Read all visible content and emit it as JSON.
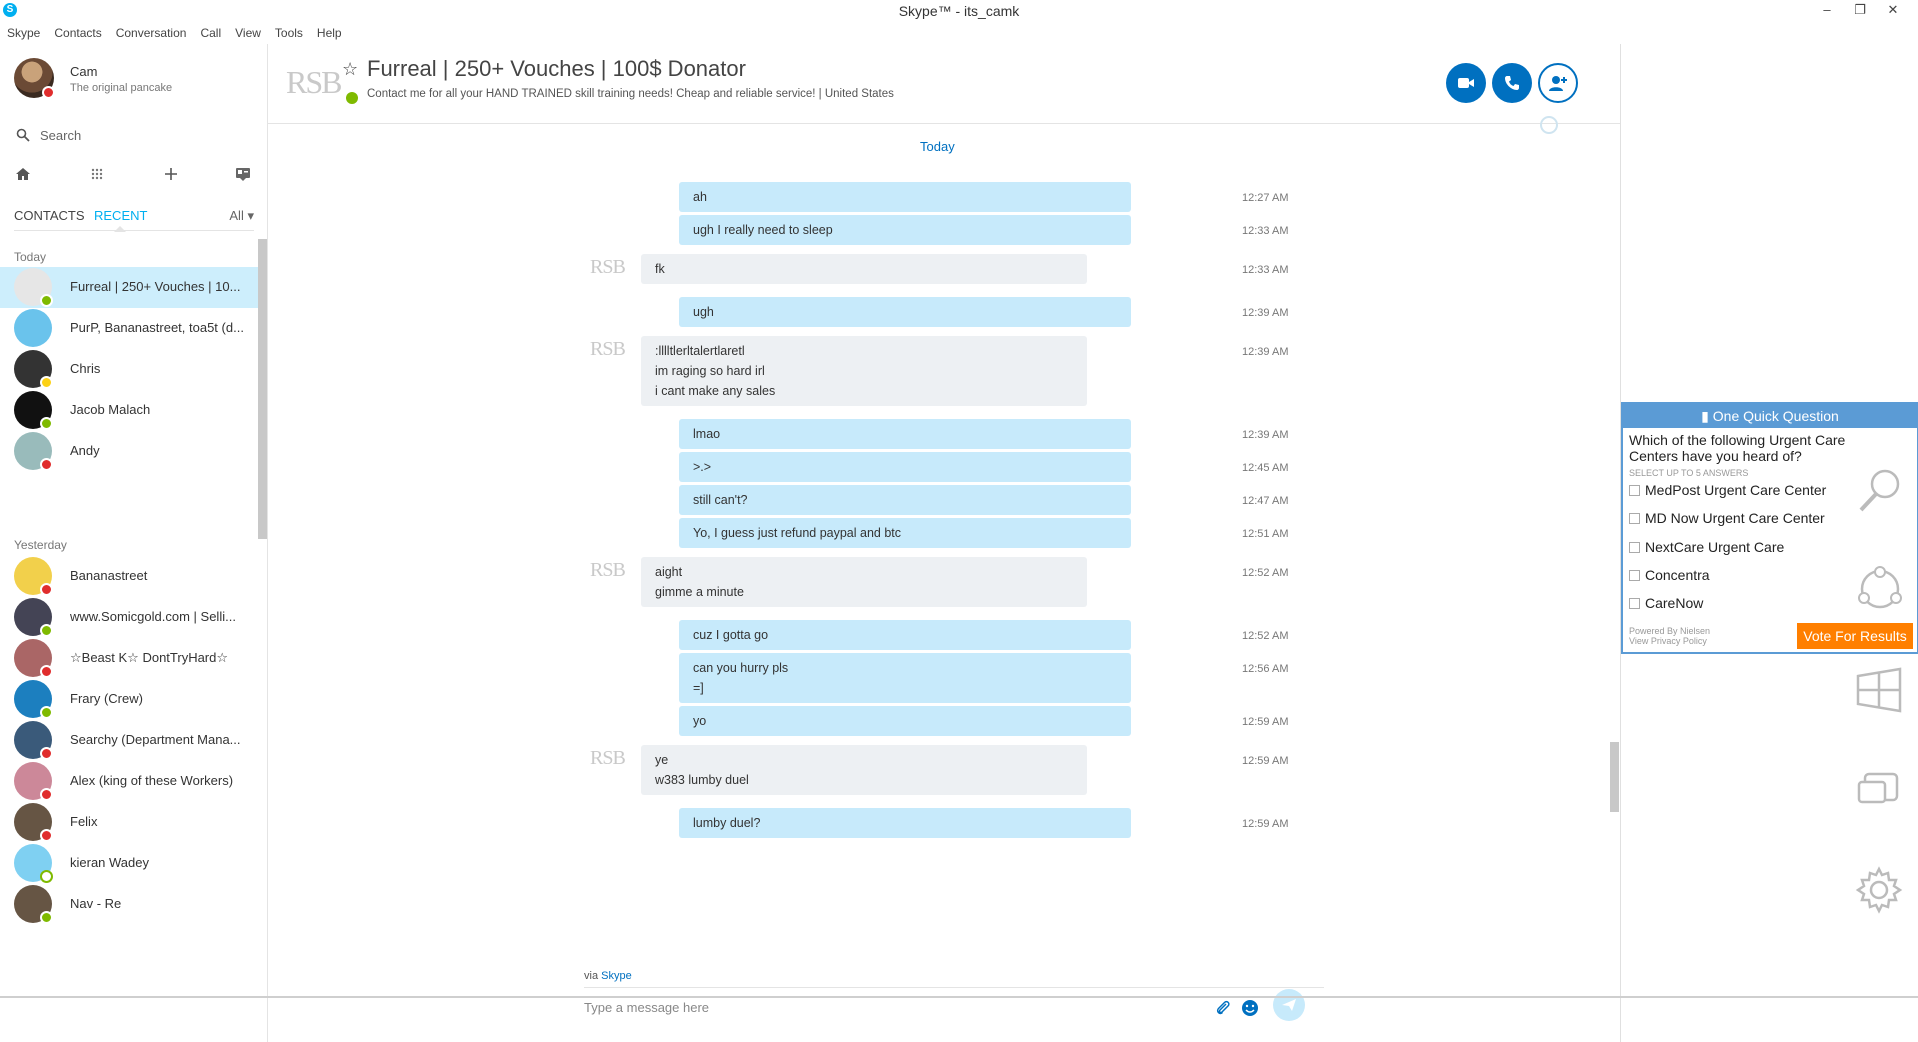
{
  "window": {
    "title": "Skype™ - its_camk",
    "minimize": "–",
    "restore": "❐",
    "close": "✕"
  },
  "menu": [
    "Skype",
    "Contacts",
    "Conversation",
    "Call",
    "View",
    "Tools",
    "Help"
  ],
  "profile": {
    "name": "Cam",
    "mood": "The original pancake",
    "status": "dnd"
  },
  "search": {
    "placeholder": "Search"
  },
  "nav_icons": [
    "home-icon",
    "dialpad-icon",
    "add-icon",
    "contacts-card-icon"
  ],
  "tabs": {
    "contacts": "CONTACTS",
    "recent": "RECENT",
    "filter": "All"
  },
  "groups": {
    "today": "Today",
    "yesterday": "Yesterday"
  },
  "contacts_today": [
    {
      "name": "Furreal | 250+ Vouches | 10...",
      "status": "online",
      "active": true
    },
    {
      "name": "PurP, Bananastreet, toa5t (d...",
      "status": "none"
    },
    {
      "name": "Chris",
      "status": "away"
    },
    {
      "name": "Jacob Malach",
      "status": "online"
    },
    {
      "name": "Andy",
      "status": "dnd"
    }
  ],
  "contacts_yesterday": [
    {
      "name": "Bananastreet",
      "status": "dnd"
    },
    {
      "name": "www.Somicgold.com  | Selli...",
      "status": "online"
    },
    {
      "name": "☆Beast K☆ DontTryHard☆",
      "status": "dnd"
    },
    {
      "name": "Frary (Crew)",
      "status": "online"
    },
    {
      "name": "Searchy (Department Mana...",
      "status": "dnd"
    },
    {
      "name": "Alex (king of these Workers)",
      "status": "dnd"
    },
    {
      "name": "Felix",
      "status": "dnd"
    },
    {
      "name": "kieran Wadey",
      "status": "offline"
    },
    {
      "name": "Nav - Re",
      "status": "online"
    }
  ],
  "conversation": {
    "logo_text": "RSB",
    "title": "Furreal | 250+ Vouches | 100$ Donator",
    "mood": "Contact me for all your HAND TRAINED skill training needs! Cheap and reliable service!  |  United States",
    "day_label": "Today",
    "call_buttons": [
      "video-call-icon",
      "voice-call-icon",
      "add-people-icon"
    ],
    "messages": [
      {
        "dir": "out",
        "lines": [
          "ah"
        ],
        "time": "12:27 AM"
      },
      {
        "dir": "out",
        "lines": [
          "ugh I really need to sleep"
        ],
        "time": "12:33 AM"
      },
      {
        "dir": "in",
        "lines": [
          "fk"
        ],
        "time": "12:33 AM"
      },
      {
        "dir": "out",
        "lines": [
          "ugh"
        ],
        "time": "12:39 AM"
      },
      {
        "dir": "in",
        "lines": [
          ":lllltlerltalertlaretl",
          "im raging so hard irl",
          "i cant make any sales"
        ],
        "time": "12:39 AM"
      },
      {
        "dir": "out",
        "lines": [
          "lmao"
        ],
        "time": "12:39 AM"
      },
      {
        "dir": "out",
        "lines": [
          ">.>"
        ],
        "time": "12:45 AM"
      },
      {
        "dir": "out",
        "lines": [
          "still can't?"
        ],
        "time": "12:47 AM"
      },
      {
        "dir": "out",
        "lines": [
          "Yo, I guess just refund paypal and btc"
        ],
        "time": "12:51 AM"
      },
      {
        "dir": "in",
        "lines": [
          "aight",
          "gimme a minute"
        ],
        "time": "12:52 AM"
      },
      {
        "dir": "out",
        "lines": [
          "cuz I gotta go"
        ],
        "time": "12:52 AM"
      },
      {
        "dir": "out",
        "lines": [
          "can you hurry pls",
          "=]"
        ],
        "time": "12:56 AM"
      },
      {
        "dir": "out",
        "lines": [
          "yo"
        ],
        "time": "12:59 AM"
      },
      {
        "dir": "in",
        "lines": [
          "ye",
          "w383 lumby duel"
        ],
        "time": "12:59 AM"
      },
      {
        "dir": "out",
        "lines": [
          "lumby duel?"
        ],
        "time": "12:59 AM"
      }
    ],
    "via_prefix": "via",
    "via_link": "Skype",
    "composer_placeholder": "Type a message here"
  },
  "ad": {
    "header": "One Quick Question",
    "question": "Which of the following Urgent Care Centers have you heard of?",
    "sub": "SELECT UP TO 5 ANSWERS",
    "options": [
      "MedPost Urgent Care Center",
      "MD Now Urgent Care Center",
      "NextCare Urgent Care",
      "Concentra",
      "CareNow"
    ],
    "footer1": "Powered By Nielsen",
    "footer2": "View Privacy Policy",
    "button": "Vote For Results",
    "accent": "#5b9bd5",
    "button_color": "#ff7f00"
  },
  "colors": {
    "skype_blue": "#00aff0",
    "outgoing_bubble": "#c7eafb",
    "incoming_bubble": "#edf0f3",
    "active_row": "#cdeefc",
    "online": "#7fba00",
    "dnd": "#e02d2d",
    "away": "#fcd116"
  }
}
